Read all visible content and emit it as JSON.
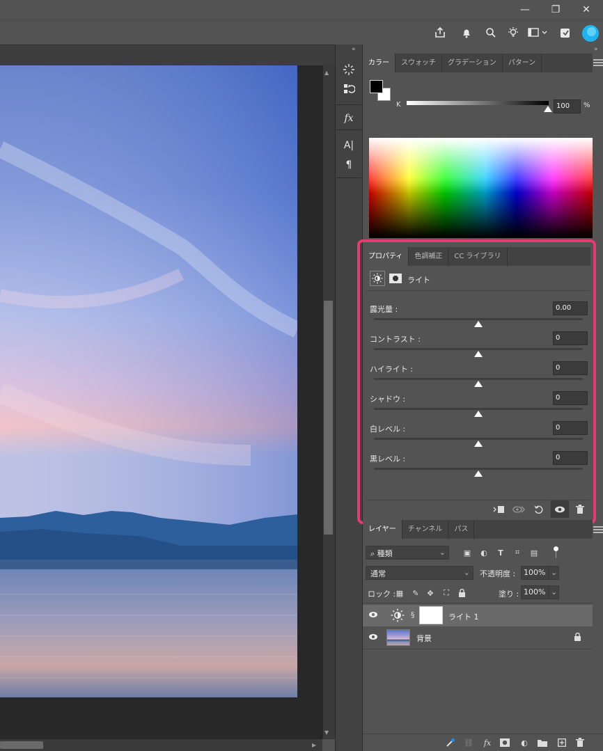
{
  "window": {
    "minimize_glyph": "—",
    "maximize_glyph": "❐",
    "close_glyph": "✕"
  },
  "toolbar_icons": [
    "share-icon",
    "bell-icon",
    "search-icon",
    "lightbulb-icon",
    "workspace-icon",
    "plugins-icon",
    "cc-icon"
  ],
  "colors": {
    "accent_highlight": "#e83a72",
    "cc_blue": "#1fb4f0",
    "panel_bg": "#535353",
    "canvas_bg": "#282828"
  },
  "color_panel": {
    "tabs": [
      "カラー",
      "スウォッチ",
      "グラデーション",
      "パターン"
    ],
    "active_tab": 0,
    "channel_label": "K",
    "value": "100",
    "unit": "%"
  },
  "properties_panel": {
    "tabs": [
      "プロパティ",
      "色調補正",
      "CC ライブラリ"
    ],
    "active_tab": 0,
    "adjustment_name": "ライト",
    "sliders": [
      {
        "label": "露光量 :",
        "value": "0.00",
        "level": 0.5
      },
      {
        "label": "コントラスト :",
        "value": "0",
        "level": 0.5
      },
      {
        "label": "ハイライト :",
        "value": "0",
        "level": 0.5
      },
      {
        "label": "シャドウ :",
        "value": "0",
        "level": 0.5
      },
      {
        "label": "白レベル :",
        "value": "0",
        "level": 0.5
      },
      {
        "label": "黒レベル :",
        "value": "0",
        "level": 0.5
      }
    ]
  },
  "layers_panel": {
    "tabs": [
      "レイヤー",
      "チャンネル",
      "パス"
    ],
    "active_tab": 0,
    "filter_kind": "種類",
    "blend_mode": "通常",
    "opacity_label": "不透明度 :",
    "opacity_value": "100%",
    "lock_label": "ロック :",
    "fill_label": "塗り :",
    "fill_value": "100%",
    "layers": [
      {
        "name": "ライト 1",
        "selected": true
      },
      {
        "name": "背景",
        "selected": false
      }
    ]
  }
}
